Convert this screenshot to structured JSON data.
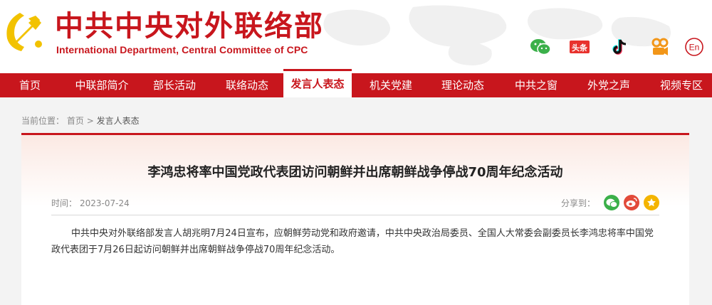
{
  "header": {
    "title": "中共中央对外联络部",
    "subtitle": "International Department, Central Committee of CPC",
    "social": [
      {
        "name": "wechat-icon"
      },
      {
        "name": "toutiao-icon",
        "text": "头条"
      },
      {
        "name": "tiktok-icon"
      },
      {
        "name": "weibo-video-icon"
      },
      {
        "name": "english-icon",
        "text": "En"
      }
    ]
  },
  "nav": {
    "items": [
      {
        "label": "首页"
      },
      {
        "label": "中联部简介"
      },
      {
        "label": "部长活动"
      },
      {
        "label": "联络动态"
      },
      {
        "label": "发言人表态"
      },
      {
        "label": "机关党建"
      },
      {
        "label": "理论动态"
      },
      {
        "label": "中共之窗"
      },
      {
        "label": "外党之声"
      },
      {
        "label": "视频专区"
      }
    ],
    "active": "发言人表态"
  },
  "breadcrumb": {
    "label": "当前位置：",
    "home": "首页",
    "separator": ">",
    "current": "发言人表态"
  },
  "article": {
    "title": "李鸿忠将率中国党政代表团访问朝鲜并出席朝鲜战争停战70周年纪念活动",
    "time_label": "时间：",
    "time": "2023-07-24",
    "share_label": "分享到：",
    "share_buttons": [
      "wechat-share-icon",
      "weibo-share-icon",
      "favorite-icon"
    ],
    "body": "中共中央对外联络部发言人胡兆明7月24日宣布，应朝鲜劳动党和政府邀请，中共中央政治局委员、全国人大常委会副委员长李鸿忠将率中国党政代表团于7月26日起访问朝鲜并出席朝鲜战争停战70周年纪念活动。"
  },
  "colors": {
    "brand_red": "#c8161d",
    "wechat_green": "#3bb04a",
    "weibo_red": "#e24a3a",
    "favorite_yellow": "#f4b400"
  }
}
